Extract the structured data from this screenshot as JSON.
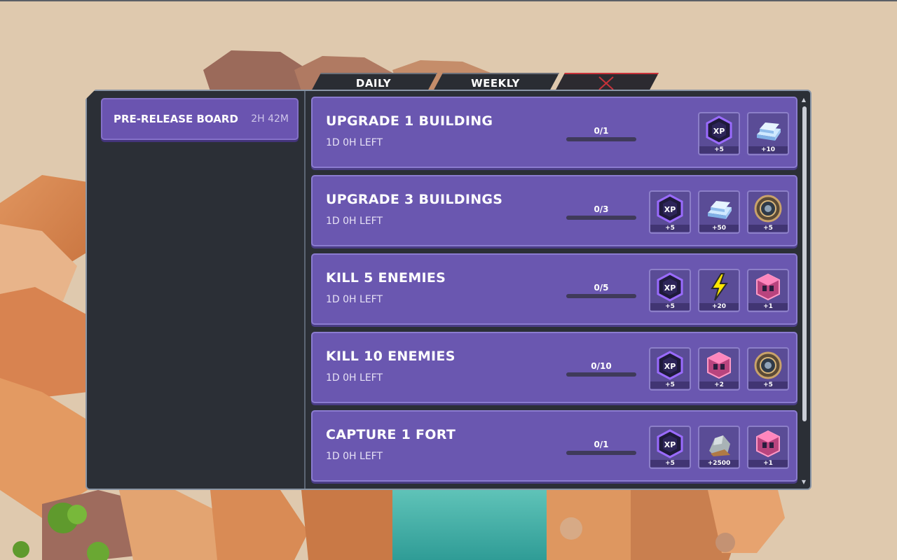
{
  "tabs": {
    "daily": "DAILY",
    "weekly": "WEEKLY"
  },
  "board": {
    "name": "PRE-RELEASE BOARD",
    "time_left": "2H 42M"
  },
  "colors": {
    "close_accent": "#c8323a",
    "card_purple": "#6a57b0"
  },
  "quests": [
    {
      "title": "UPGRADE 1 BUILDING",
      "time_left": "1D 0H LEFT",
      "progress": "0/1",
      "progress_fraction": 0,
      "rewards": [
        {
          "icon": "xp-icon",
          "amount": "+5"
        },
        {
          "icon": "ingot-icon",
          "amount": "+10"
        }
      ]
    },
    {
      "title": "UPGRADE 3 BUILDINGS",
      "time_left": "1D 0H LEFT",
      "progress": "0/3",
      "progress_fraction": 0,
      "rewards": [
        {
          "icon": "xp-icon",
          "amount": "+5"
        },
        {
          "icon": "ingot-icon",
          "amount": "+50"
        },
        {
          "icon": "coin-icon",
          "amount": "+5"
        }
      ]
    },
    {
      "title": "KILL 5 ENEMIES",
      "time_left": "1D 0H LEFT",
      "progress": "0/5",
      "progress_fraction": 0,
      "rewards": [
        {
          "icon": "xp-icon",
          "amount": "+5"
        },
        {
          "icon": "lightning-icon",
          "amount": "+20"
        },
        {
          "icon": "crystal-cube-icon",
          "amount": "+1"
        }
      ]
    },
    {
      "title": "KILL 10 ENEMIES",
      "time_left": "1D 0H LEFT",
      "progress": "0/10",
      "progress_fraction": 0,
      "rewards": [
        {
          "icon": "xp-icon",
          "amount": "+5"
        },
        {
          "icon": "crystal-cube-icon",
          "amount": "+2"
        },
        {
          "icon": "coin-icon",
          "amount": "+5"
        }
      ]
    },
    {
      "title": "CAPTURE 1 FORT",
      "time_left": "1D 0H LEFT",
      "progress": "0/1",
      "progress_fraction": 0,
      "rewards": [
        {
          "icon": "xp-icon",
          "amount": "+5"
        },
        {
          "icon": "ore-icon",
          "amount": "+2500"
        },
        {
          "icon": "crystal-cube-icon",
          "amount": "+1"
        }
      ]
    }
  ]
}
